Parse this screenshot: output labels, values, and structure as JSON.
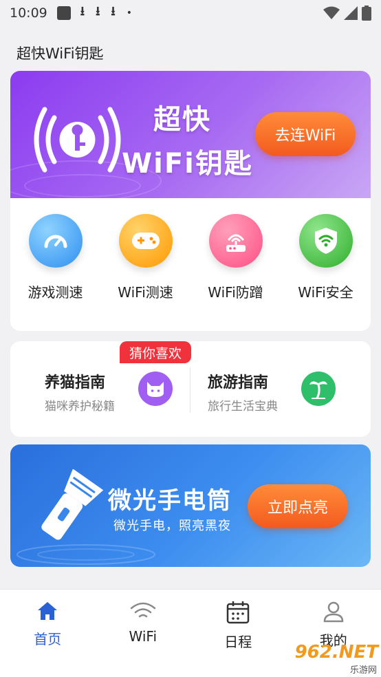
{
  "status_bar": {
    "time": "10:09",
    "download_icons": [
      "⭳",
      "⭳",
      "⭳"
    ],
    "dot": "•"
  },
  "app_title": "超快WiFi钥匙",
  "hero": {
    "title_line1": "超快",
    "title_line2": "WiFi钥匙",
    "button_label": "去连WiFi"
  },
  "tools": [
    {
      "label": "游戏测速",
      "icon": "speedometer-icon",
      "color": "#4aa8f5"
    },
    {
      "label": "WiFi测速",
      "icon": "gamepad-icon",
      "color": "#ffa31a"
    },
    {
      "label": "WiFi防蹭",
      "icon": "router-icon",
      "color": "#ff5f8f"
    },
    {
      "label": "WiFi安全",
      "icon": "shield-wifi-icon",
      "color": "#4cc24a"
    }
  ],
  "guess": {
    "badge": "猜你喜欢",
    "items": [
      {
        "title": "养猫指南",
        "subtitle": "猫咪养护秘籍",
        "icon": "cat-icon",
        "color": "#a05ef2"
      },
      {
        "title": "旅游指南",
        "subtitle": "旅行生活宝典",
        "icon": "palm-tree-icon",
        "color": "#2fbf6b"
      }
    ]
  },
  "flashlight": {
    "title": "微光手电筒",
    "subtitle": "微光手电，照亮黑夜",
    "button_label": "立即点亮"
  },
  "bottom_nav": [
    {
      "label": "首页",
      "icon": "home-icon",
      "active": true
    },
    {
      "label": "WiFi",
      "icon": "wifi-icon",
      "active": false
    },
    {
      "label": "日程",
      "icon": "calendar-icon",
      "active": false
    },
    {
      "label": "我的",
      "icon": "user-icon",
      "active": false
    }
  ],
  "watermark": {
    "main": "962.NET",
    "sub": "乐游网"
  },
  "colors": {
    "accent": "#2a62d6",
    "hero_purple": "#8b3cf0",
    "cta_orange": "#f35a1e",
    "flash_blue": "#2a6fdc",
    "badge_red": "#f0323c"
  }
}
